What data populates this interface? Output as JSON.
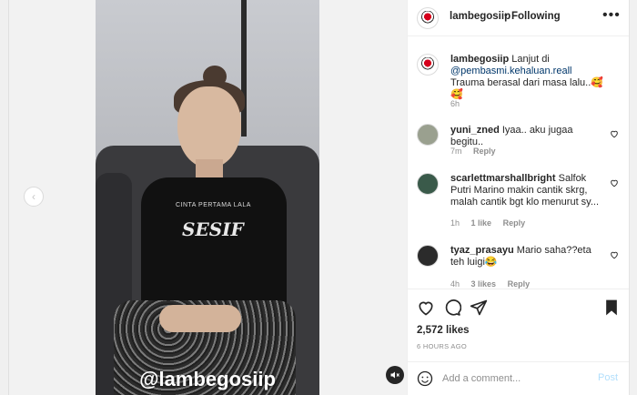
{
  "media": {
    "watermark": "@lambegosiip",
    "shirt_print_small": "CINTA PERTAMA LALA",
    "shirt_print_large": "SESIF"
  },
  "header": {
    "username": "lambegosiip",
    "separator": "•",
    "follow_status": "Following"
  },
  "caption": {
    "username": "lambegosiip",
    "text_before": "Lanjut di",
    "mention": "@pembasmi.kehaluan.reall",
    "text_after": "Trauma berasal dari masa lalu..🥰🥰",
    "time": "6h"
  },
  "comments": [
    {
      "username": "yuni_zned",
      "text": "Iyaa.. aku jugaa begitu..",
      "time": "7m",
      "likes": "",
      "reply": "Reply"
    },
    {
      "username": "scarlettmarshallbright",
      "text": "Salfok Putri Marino makin cantik skrg, malah cantik bgt klo menurut sy...",
      "time": "1h",
      "likes": "1 like",
      "reply": "Reply"
    },
    {
      "username": "tyaz_prasayu",
      "text": "Mario saha??eta teh luigi😂",
      "time": "4h",
      "likes": "3 likes",
      "reply": "Reply"
    }
  ],
  "actions": {
    "likes": "2,572 likes",
    "time_ago": "6 HOURS AGO"
  },
  "compose": {
    "placeholder": "Add a comment...",
    "post_label": "Post"
  },
  "colors": {
    "link": "#00376b",
    "meta": "#8e8e8e",
    "post_disabled": "#b2dffc"
  }
}
